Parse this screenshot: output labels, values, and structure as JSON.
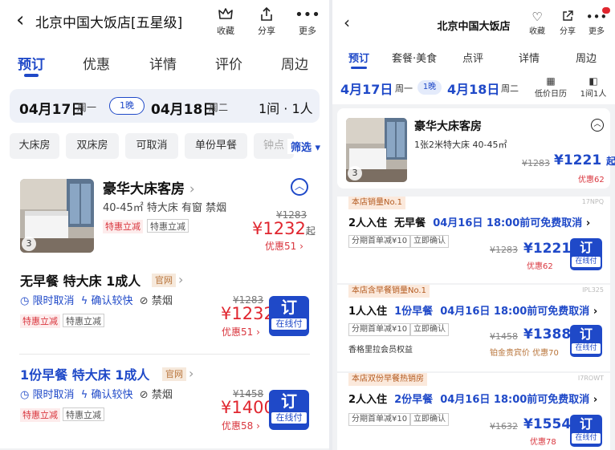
{
  "left": {
    "header": {
      "back_icon": "‹",
      "title": "北京中国大饭店[五星级]",
      "actions": [
        {
          "icon": "crown-icon",
          "label": "收藏"
        },
        {
          "icon": "share-icon",
          "label": "分享"
        },
        {
          "icon": "more-icon",
          "label": "更多"
        }
      ]
    },
    "tabs": [
      "预订",
      "优惠",
      "详情",
      "评价",
      "周边"
    ],
    "date": {
      "checkin": "04月17日",
      "checkin_weekday": "周一",
      "nights": "1晚",
      "checkout": "04月18日",
      "checkout_weekday": "周二",
      "rooms_guests": "1间 · 1人"
    },
    "filters": [
      "大床房",
      "双床房",
      "可取消",
      "单份早餐",
      "钟点"
    ],
    "filter_button": "筛选 ▾",
    "room": {
      "name": "豪华大床客房",
      "spec": "40-45㎡ 特大床 有窗 禁烟",
      "photo_count": "3",
      "tags": [
        "特惠立减",
        "特惠立减"
      ],
      "original_price": "¥1283",
      "price": "¥1232",
      "price_suffix": "起",
      "saving": "优惠51"
    },
    "rates": [
      {
        "title": "无早餐 特大床 1成人",
        "official": "官网",
        "features": [
          "限时取消",
          "确认较快",
          "禁烟"
        ],
        "tags": [
          "特惠立减",
          "特惠立减"
        ],
        "original_price": "¥1283",
        "price": "¥1232",
        "saving": "优惠51",
        "book": "订",
        "pay": "在线付"
      },
      {
        "title": "1份早餐 特大床 1成人",
        "official": "官网",
        "features": [
          "限时取消",
          "确认较快",
          "禁烟"
        ],
        "tags": [
          "特惠立减",
          "特惠立减"
        ],
        "original_price": "¥1458",
        "price": "¥1400",
        "saving": "优惠58",
        "book": "订",
        "pay": "在线付"
      }
    ]
  },
  "right": {
    "header": {
      "back_icon": "‹",
      "title": "北京中国大饭店",
      "actions": [
        {
          "icon": "heart-icon",
          "label": "收藏"
        },
        {
          "icon": "share-icon",
          "label": "分享"
        },
        {
          "icon": "more-icon",
          "label": "更多"
        }
      ]
    },
    "tabs": [
      "预订",
      "套餐·美食",
      "点评",
      "详情",
      "周边"
    ],
    "date": {
      "checkin": "4月17日",
      "checkin_weekday": "周一",
      "nights": "1晚",
      "checkout": "4月18日",
      "checkout_weekday": "周二",
      "calendar_label": "低价日历",
      "guests_label": "1间1人"
    },
    "room": {
      "name": "豪华大床客房",
      "spec": "1张2米特大床  40-45㎡",
      "photo_count": "3",
      "original_price": "¥1283",
      "price": "¥1221",
      "price_suffix": "起",
      "saving": "优惠62"
    },
    "rates": [
      {
        "badge": "本店销量No.1",
        "code": "17NPQ",
        "guests": "2人入住",
        "breakfast": "无早餐",
        "cancel": "04月16日 18:00前可免费取消",
        "tags": [
          "分期首单减¥10",
          "立即确认"
        ],
        "member": "",
        "original_price": "¥1283",
        "price": "¥1221",
        "saving": "优惠62",
        "book": "订",
        "pay": "在线付"
      },
      {
        "badge": "本店含早餐销量No.1",
        "code": "IPL325",
        "guests": "1人入住",
        "breakfast": "1份早餐",
        "cancel": "04月16日 18:00前可免费取消",
        "tags": [
          "分期首单减¥10",
          "立即确认"
        ],
        "member": "香格里拉会员权益",
        "original_price": "¥1458",
        "price": "¥1388",
        "saving": "铂金贵宾价 优惠70",
        "book": "订",
        "pay": "在线付"
      },
      {
        "badge": "本店双份早餐热销房",
        "code": "I7ROWT",
        "guests": "2人入住",
        "breakfast": "2份早餐",
        "cancel": "04月16日 18:00前可免费取消",
        "tags": [
          "分期首单减¥10",
          "立即确认"
        ],
        "member": "",
        "original_price": "¥1632",
        "price": "¥1554",
        "saving": "优惠78",
        "book": "订",
        "pay": "在线付"
      }
    ]
  },
  "colors": {
    "accent": "#1f49c8",
    "price_red": "#e0262f",
    "tag_red_bg": "#fdecec",
    "official_bg": "#f6e9dc"
  }
}
